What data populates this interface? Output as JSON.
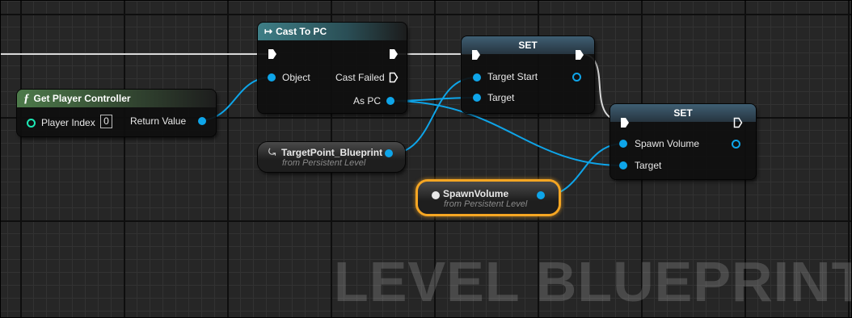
{
  "watermark": "LEVEL BLUEPRINT",
  "colors": {
    "object_pin": "#0ea5e9",
    "exec_pin": "#ffffff",
    "int_pin": "#1de9b6",
    "selection": "#f5a623"
  },
  "nodes": {
    "get_player_controller": {
      "title": "Get Player Controller",
      "icon": "function-icon",
      "player_index_label": "Player Index",
      "player_index_value": "0",
      "return_value_label": "Return Value"
    },
    "cast_to_pc": {
      "title": "Cast To PC",
      "icon": "cast-arrow-icon",
      "object_label": "Object",
      "cast_failed_label": "Cast Failed",
      "as_pc_label": "As PC"
    },
    "set_1": {
      "title": "SET",
      "target_start_label": "Target Start",
      "target_label": "Target"
    },
    "set_2": {
      "title": "SET",
      "spawn_volume_label": "Spawn Volume",
      "target_label": "Target"
    },
    "target_point": {
      "name": "TargetPoint_Blueprint",
      "icon": "reference-icon",
      "subtitle": "from Persistent Level"
    },
    "spawn_volume": {
      "name": "SpawnVolume",
      "icon": "reference-icon",
      "subtitle": "from Persistent Level"
    }
  }
}
